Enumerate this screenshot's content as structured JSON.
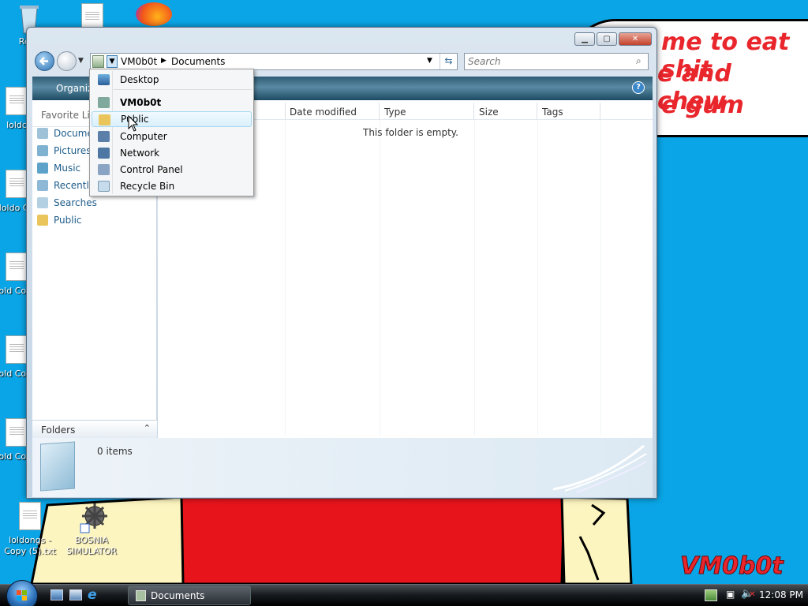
{
  "desktop": {
    "icons": [
      {
        "label": "Recy",
        "icon": "recycle-bin-icon"
      },
      {
        "label": "loldc",
        "icon": "text-file-icon"
      },
      {
        "label": "loldo Co",
        "icon": "text-file-icon"
      },
      {
        "label": "lold Copy",
        "icon": "text-file-icon"
      },
      {
        "label": "lold Copy",
        "icon": "text-file-icon"
      },
      {
        "label": "lold Copy",
        "icon": "text-file-icon"
      },
      {
        "label": "loldongs - Copy (5).txt",
        "icon": "text-file-icon"
      },
      {
        "label": "BOSNIA SIMULATOR",
        "icon": "mine-shortcut-icon"
      }
    ],
    "speech_lines": [
      "me to eat shit",
      "e and chew",
      "e gum"
    ],
    "signature": "VM0b0t",
    "colors": {
      "background": "#0aa5e6",
      "speech_text": "#e8262c",
      "skin": "#fdf5c0",
      "shirt": "#e8141c"
    }
  },
  "explorer": {
    "breadcrumb": [
      "VM0b0t",
      "Documents"
    ],
    "search_placeholder": "Search",
    "toolbar_organize": "Organiz",
    "favorite_links_label": "Favorite Lin",
    "nav_items": [
      {
        "label": "Docume",
        "icon": "documents-icon"
      },
      {
        "label": "Pictures",
        "icon": "pictures-icon"
      },
      {
        "label": "Music",
        "icon": "music-icon"
      },
      {
        "label": "Recently",
        "icon": "recent-icon"
      },
      {
        "label": "Searches",
        "icon": "searches-icon"
      },
      {
        "label": "Public",
        "icon": "folder-icon"
      }
    ],
    "columns": [
      "Date modified",
      "Type",
      "Size",
      "Tags"
    ],
    "empty_message": "This folder is empty.",
    "folders_label": "Folders",
    "item_count": "0 items"
  },
  "dropdown": {
    "items": [
      {
        "label": "Desktop",
        "icon": "desktop-icon",
        "bold": false
      },
      {
        "label": "VM0b0t",
        "icon": "user-folder-icon",
        "bold": true
      },
      {
        "label": "Public",
        "icon": "folder-icon",
        "bold": false,
        "hover": true
      },
      {
        "label": "Computer",
        "icon": "computer-icon",
        "bold": false
      },
      {
        "label": "Network",
        "icon": "network-icon",
        "bold": false
      },
      {
        "label": "Control Panel",
        "icon": "control-panel-icon",
        "bold": false
      },
      {
        "label": "Recycle Bin",
        "icon": "recycle-bin-icon",
        "bold": false
      }
    ]
  },
  "taskbar": {
    "active_window": "Documents",
    "clock": "12:08 PM"
  }
}
